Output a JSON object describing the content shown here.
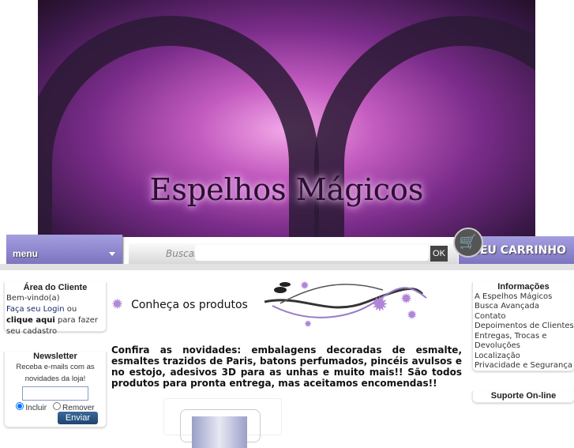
{
  "banner": {
    "logo_text": "Espelhos Mágicos"
  },
  "nav": {
    "menu_label": "menu",
    "search_label": "Buscar",
    "search_value": "",
    "ok_label": "OK",
    "cart_label": "MEU CARRINHO"
  },
  "client_area": {
    "title": "Área do Cliente",
    "welcome": "Bem-vindo(a)",
    "login_link": "Faça seu Login",
    "or": " ou ",
    "signup_link": "clique aqui",
    "signup_rest": " para fazer seu cadastro"
  },
  "newsletter": {
    "title": "Newsletter",
    "text": "Receba e-mails com as novidades da loja!",
    "email_value": "",
    "opt_include": "Incluir",
    "opt_remove": "Remover",
    "send_label": "Enviar"
  },
  "main": {
    "heading": "Conheça os produtos",
    "description": "Confira as novidades: embalagens decoradas de esmalte, esmaltes trazidos de Paris, batons perfumados, pincéis avulsos e no estojo, adesivos 3D para as unhas e muito mais!! São todos produtos para pronta entrega, mas aceitamos encomendas!!"
  },
  "info": {
    "title": "Informações",
    "links": [
      "A Espelhos Mágicos",
      "Busca Avançada",
      "Contato",
      "Depoimentos de Clientes",
      "Entregas, Trocas e Devoluções",
      "Localização",
      "Privacidade e Segurança"
    ]
  },
  "support": {
    "title": "Suporte On-line"
  }
}
